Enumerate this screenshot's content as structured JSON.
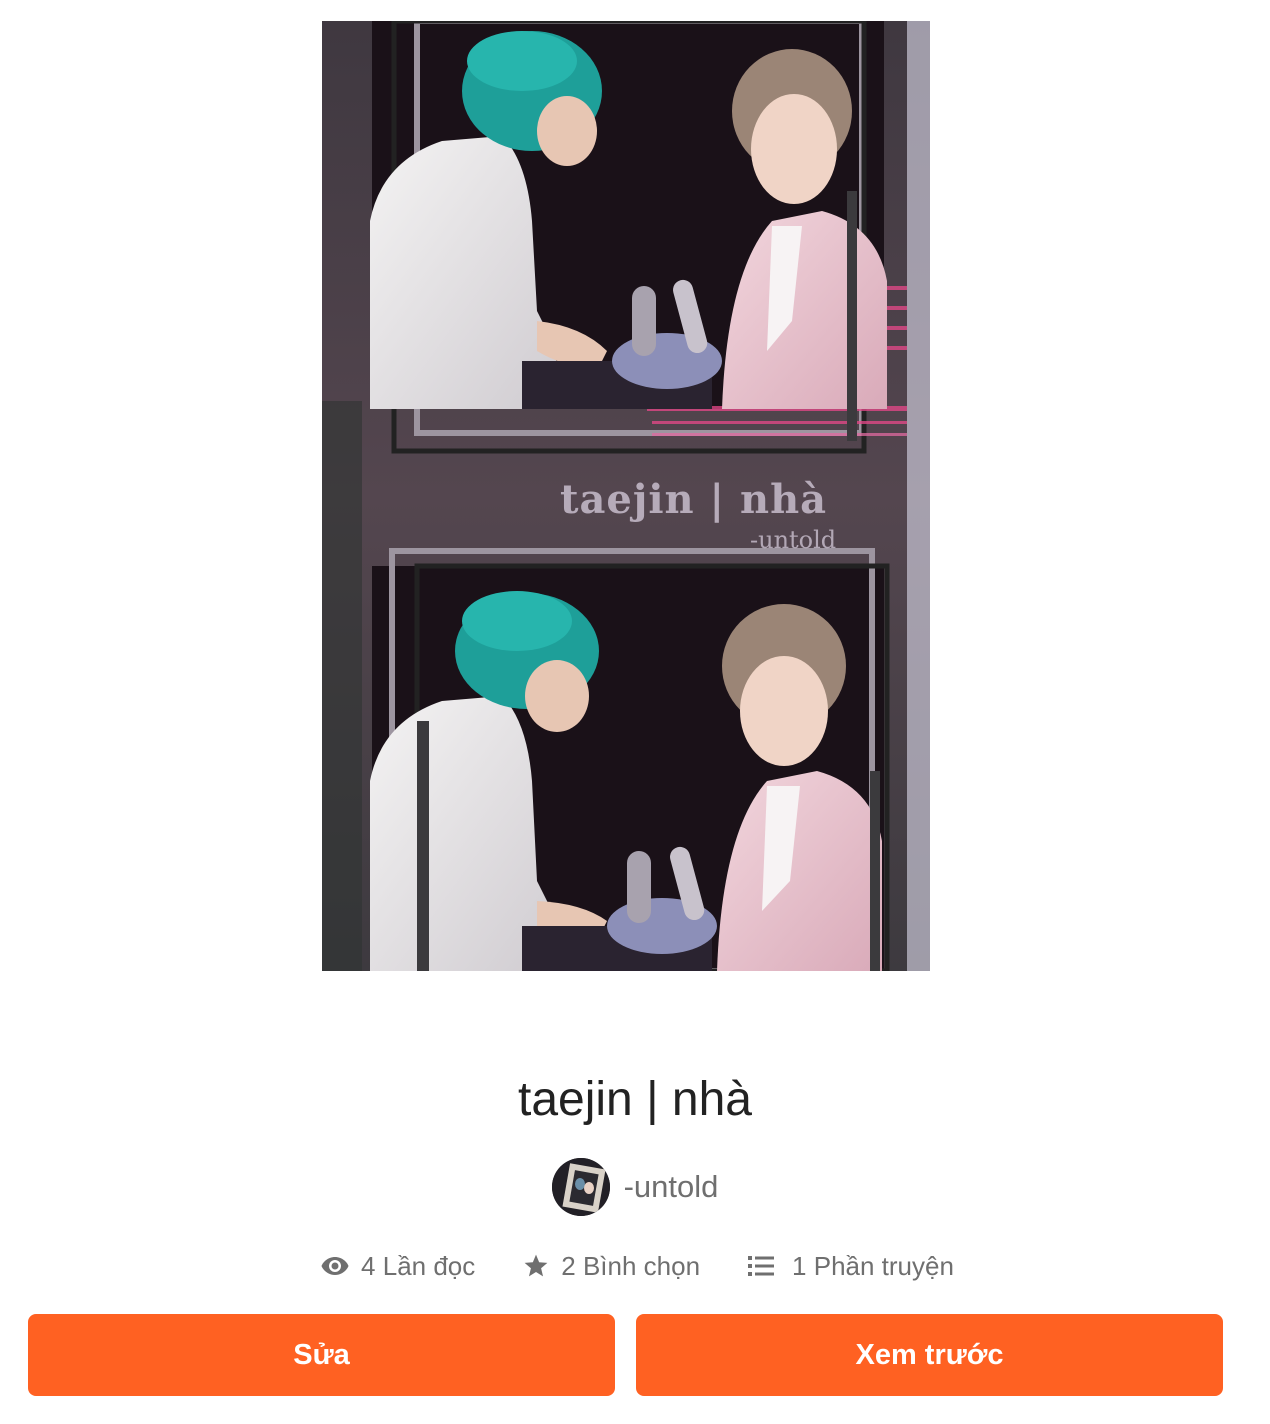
{
  "cover": {
    "caption": "taejin | nhà",
    "subcaption": "-untold"
  },
  "story": {
    "title": "taejin | nhà",
    "author": "-untold"
  },
  "stats": {
    "reads": "4 Lần đọc",
    "votes": "2 Bình chọn",
    "parts": "1 Phần truyện"
  },
  "actions": {
    "edit_label": "Sửa",
    "preview_label": "Xem trước"
  },
  "colors": {
    "accent": "#ff6122",
    "muted_text": "#6f6f6f",
    "title_text": "#222222"
  },
  "icons": {
    "reads": "eye-icon",
    "votes": "star-icon",
    "parts": "list-icon"
  }
}
